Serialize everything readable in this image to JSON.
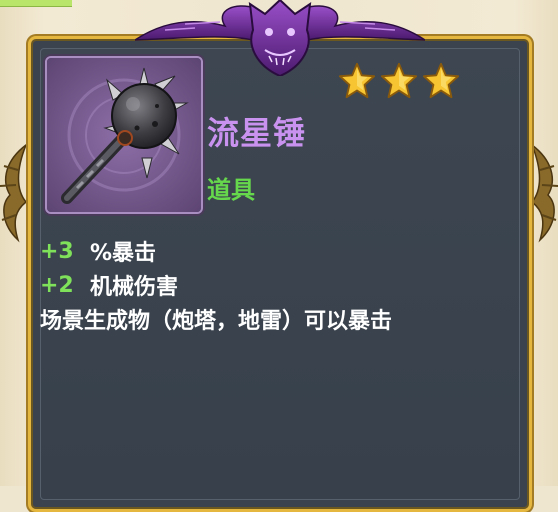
{
  "item": {
    "name": "流星锤",
    "type": "道具",
    "star_count": 3,
    "name_color": "#c992ee",
    "type_color": "#66d84c",
    "icon": "spiked-mace-icon"
  },
  "stats": [
    {
      "value": "+3",
      "label": "%暴击"
    },
    {
      "value": "+2",
      "label": "机械伤害"
    }
  ],
  "description": "场景生成物（炮塔，地雷）可以暴击",
  "colors": {
    "frame_gold": "#e5b73e",
    "panel_bg": "#3b434e",
    "stat_value_green": "#7fe05a",
    "star_gold": "#f6c531"
  }
}
